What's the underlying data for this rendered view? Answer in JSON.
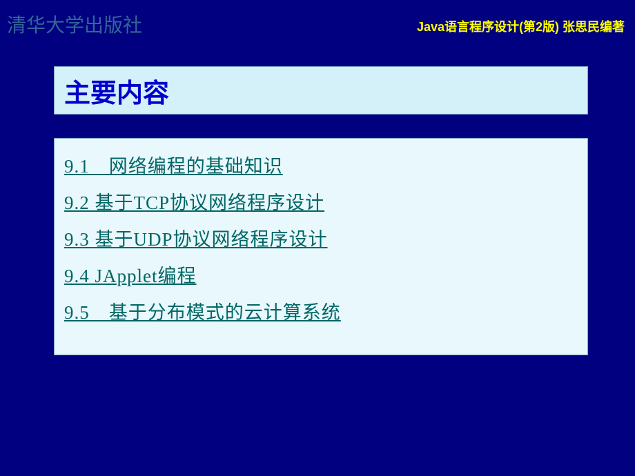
{
  "header": {
    "publisher": "清华大学出版社",
    "book_title": "Java语言程序设计(第2版)  张思民编著"
  },
  "title": "主要内容",
  "toc": {
    "items": [
      "9.1　网络编程的基础知识",
      "9.2 基于TCP协议网络程序设计",
      "9.3 基于UDP协议网络程序设计",
      "9.4 JApplet编程",
      "9.5　基于分布模式的云计算系统"
    ]
  }
}
